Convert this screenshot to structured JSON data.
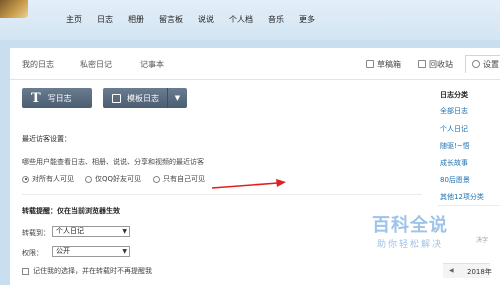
{
  "nav": {
    "items": [
      "主页",
      "日志",
      "相册",
      "留言板",
      "说说",
      "个人档",
      "音乐",
      "更多"
    ]
  },
  "tabs": {
    "my_log": "我的日志",
    "private_log": "私密日记",
    "notebook": "记事本"
  },
  "tools": {
    "draft": "草稿箱",
    "recycle": "回收站",
    "settings": "设置"
  },
  "buttons": {
    "write_log": "写日志",
    "template_log": "模板日志"
  },
  "visitors": {
    "title": "最近访客设置：",
    "question": "哪些用户能查看日志、相册、说说、分享和视频的最近访客",
    "options": [
      "对所有人可见",
      "仅QQ好友可见",
      "只有自己可见"
    ],
    "selected_index": 0
  },
  "repost": {
    "title": "转载提醒：仅在当前浏览器生效",
    "to_label": "转载到：",
    "to_value": "个人日记",
    "perm_label": "权限：",
    "perm_value": "公开",
    "remember_label": "记住我的选择，并在转载时不再提醒我"
  },
  "sidebar": {
    "title": "日志分类",
    "items": [
      "全部日志",
      "个人日记",
      "随驱!~悟",
      "成长故事",
      "80后愿景",
      "其他12项分类"
    ]
  },
  "watermark": {
    "main": "百科全说",
    "sub": "助你轻松解决"
  },
  "calendar": {
    "partial_text": "决字",
    "year_partial": "2018年"
  },
  "colors": {
    "accent_red": "#e02020",
    "link_blue": "#1a6fb3",
    "button_dark": "#56687b"
  }
}
